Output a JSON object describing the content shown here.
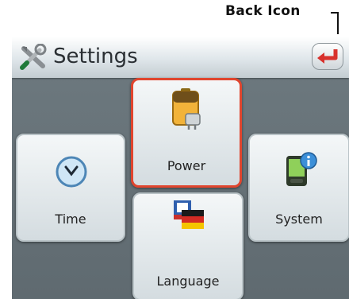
{
  "annotation": {
    "label": "Back Icon"
  },
  "header": {
    "title": "Settings"
  },
  "tiles": {
    "power": {
      "label": "Power"
    },
    "time": {
      "label": "Time"
    },
    "system": {
      "label": "System"
    },
    "language": {
      "label": "Language"
    }
  },
  "colors": {
    "selected_border": "#e0452e",
    "back_arrow": "#d8312c",
    "screen_bg": "#6e7a80"
  },
  "icons": {
    "header": "tools-icon",
    "back": "back-arrow-icon",
    "power": "battery-plug-icon",
    "time": "clock-icon",
    "system": "pda-info-icon",
    "language": "flags-icon"
  }
}
